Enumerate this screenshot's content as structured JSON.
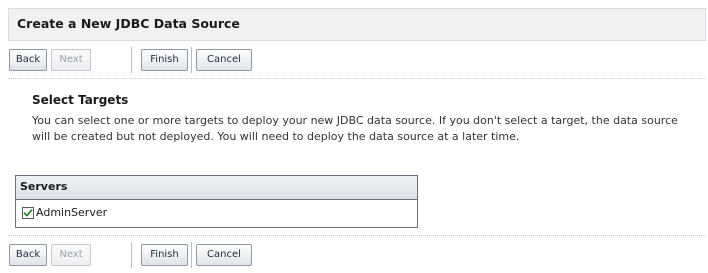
{
  "panel": {
    "title": "Create a New JDBC Data Source"
  },
  "toolbar_top": {
    "back_label": "Back",
    "next_label": "Next",
    "finish_label": "Finish",
    "cancel_label": "Cancel",
    "next_enabled": false
  },
  "section": {
    "heading": "Select Targets",
    "description": "You can select one or more targets to deploy your new JDBC data source. If you don't select a target, the data source will be created but not deployed. You will need to deploy the data source at a later time."
  },
  "servers_table": {
    "header": "Servers",
    "rows": [
      {
        "label": "AdminServer",
        "checked": true,
        "icon": "checkmark-icon"
      }
    ]
  },
  "toolbar_bottom": {
    "back_label": "Back",
    "next_label": "Next",
    "finish_label": "Finish",
    "cancel_label": "Cancel",
    "next_enabled": false
  },
  "colors": {
    "checkmark": "#2e8b2e",
    "header_bg": "#f0f1f3",
    "table_header_bg": "#dde2e8"
  }
}
